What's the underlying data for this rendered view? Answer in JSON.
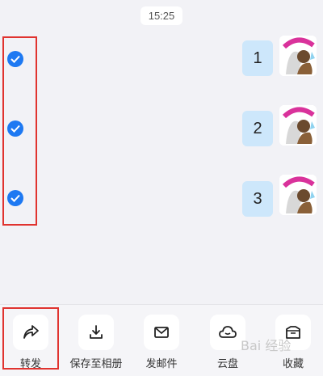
{
  "chat": {
    "time": "15:25",
    "messages": [
      {
        "text": "1",
        "checked": true
      },
      {
        "text": "2",
        "checked": true
      },
      {
        "text": "3",
        "checked": true
      }
    ]
  },
  "actions": [
    {
      "label": "转发",
      "icon": "share-icon"
    },
    {
      "label": "保存至相册",
      "icon": "download-icon"
    },
    {
      "label": "发邮件",
      "icon": "mail-icon"
    },
    {
      "label": "云盘",
      "icon": "cloud-icon"
    },
    {
      "label": "收藏",
      "icon": "favorites-box-icon"
    }
  ],
  "watermark": "Bai 经验",
  "colors": {
    "accent": "#1e79f2",
    "bubble": "#cde7fb",
    "highlight": "#e0332f"
  }
}
